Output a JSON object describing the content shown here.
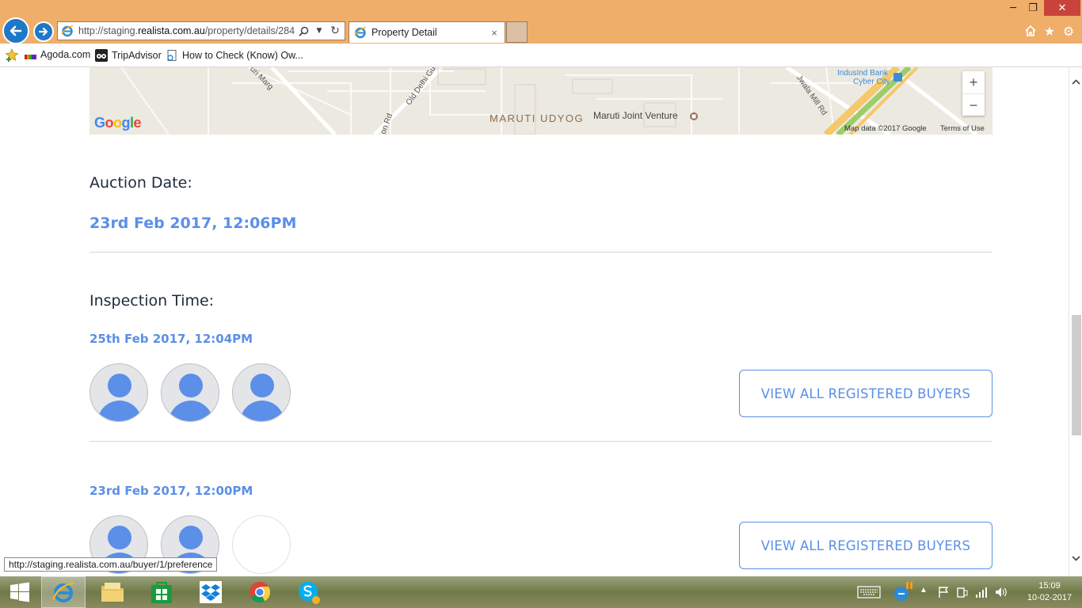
{
  "browser": {
    "url_prefix": "http://staging.",
    "url_domain": "realista.com.au",
    "url_path": "/property/details/284",
    "tab_title": "Property Detail",
    "tab_close": "×",
    "search_glyph": "⌕",
    "refresh_glyph": "↻",
    "window_min": "─",
    "window_max": "❐",
    "window_close": "✕",
    "home_glyph": "⌂",
    "favorites_glyph": "★",
    "settings_glyph": "⚙"
  },
  "favorites": [
    {
      "label": "Agoda.com",
      "icon": "agoda-icon"
    },
    {
      "label": "TripAdvisor",
      "icon": "tripadvisor-icon"
    },
    {
      "label": "How to Check (Know) Ow...",
      "icon": "page-icon"
    }
  ],
  "map": {
    "labels": {
      "puri_marg": "Puri Marg",
      "old_delhi": "Old Delhi Gu",
      "rd_left": "on Rd",
      "maruti_udyog": "MARUTI UDYOG",
      "maruti_jv": "Maruti Joint Venture",
      "indusind": "IndusInd Bank",
      "cyber_city": "Cyber City",
      "jwala": "Jwala Mill Rd",
      "map_data": "Map data ©2017 Google",
      "terms": "Terms of Use",
      "google": "Google"
    },
    "zoom_in": "+",
    "zoom_out": "−"
  },
  "auction": {
    "heading": "Auction Date:",
    "date": "23rd Feb 2017, 12:06PM"
  },
  "inspection": {
    "heading": "Inspection Time:",
    "slots": [
      {
        "date": "25th Feb 2017, 12:04PM",
        "button": "VIEW ALL REGISTERED BUYERS"
      },
      {
        "date": "23rd Feb 2017, 12:00PM",
        "button": "VIEW ALL REGISTERED BUYERS"
      }
    ]
  },
  "status_url": "http://staging.realista.com.au/buyer/1/preference",
  "taskbar": {
    "clock_time": "15:09",
    "clock_date": "10-02-2017",
    "tray_up": "▲"
  },
  "colors": {
    "accent_blue": "#5b8fe8",
    "title_bar": "#efae6a",
    "close_red": "#c8443a"
  }
}
